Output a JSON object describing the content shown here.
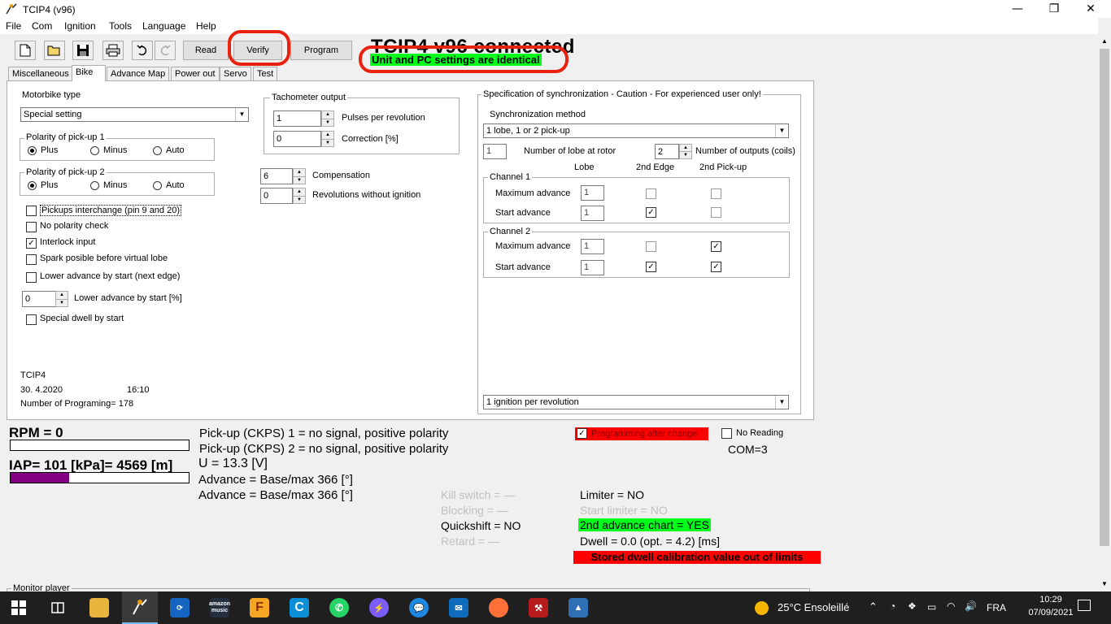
{
  "window": {
    "title": "TCIP4 (v96)",
    "min": "—",
    "max": "❐",
    "close": "✕"
  },
  "menu": [
    "File",
    "Com",
    "Ignition",
    "Tools",
    "Language",
    "Help"
  ],
  "toolbar": {
    "read": "Read",
    "verify": "Verify",
    "program": "Program"
  },
  "header": {
    "status": "TCIP4 v96 connected",
    "sub": "Unit and PC settings are identical"
  },
  "tabs": [
    "Miscellaneous",
    "Bike",
    "Advance Map",
    "Power out",
    "Servo",
    "Test"
  ],
  "bike": {
    "motorbike_type_label": "Motorbike type",
    "motorbike_type_value": "Special setting",
    "pol1_label": "Polarity of pick-up 1",
    "pol2_label": "Polarity of pick-up 2",
    "radio_options": [
      "Plus",
      "Minus",
      "Auto"
    ],
    "checks": [
      "Pickups interchange (pin 9 and 20)",
      "No polarity check",
      "Interlock input",
      "Spark posible before virtual lobe",
      "Lower advance by start (next edge)"
    ],
    "lower_adv_value": "0",
    "lower_adv_label": "Lower advance by start [%]",
    "special_dwell": "Special dwell by start",
    "tacho_label": "Tachometer output",
    "pulses_value": "1",
    "pulses_label": "Pulses per revolution",
    "correction_value": "0",
    "correction_label": "Correction [%]",
    "compensation_value": "6",
    "compensation_label": "Compensation",
    "rev_wo_ign_value": "0",
    "rev_wo_ign_label": "Revolutions without ignition",
    "info_name": "TCIP4",
    "info_date": "30. 4.2020",
    "info_time": "16:10",
    "info_prog": "Number of Programing= 178"
  },
  "sync": {
    "label": "Specification of synchronization - Caution - For experienced user only!",
    "method_label": "Synchronization method",
    "method_value": "1 lobe, 1 or 2 pick-up",
    "lobe_count": "1",
    "lobe_count_label": "Number of lobe at rotor",
    "outputs_value": "2",
    "outputs_label": "Number of outputs (coils)",
    "col_lobe": "Lobe",
    "col_edge": "2nd Edge",
    "col_pickup": "2nd Pick-up",
    "ch1_label": "Channel 1",
    "ch2_label": "Channel 2",
    "max_adv": "Maximum advance",
    "start_adv": "Start advance",
    "ch1_max_lobe": "1",
    "ch1_start_lobe": "1",
    "ch2_max_lobe": "1",
    "ch2_start_lobe": "1",
    "ign_per_rev": "1 ignition per revolution"
  },
  "status": {
    "rpm": "RPM = 0",
    "iap": "IAP= 101 [kPa]= 4569 [m]",
    "iap_level": 0.33,
    "pickup1": "Pick-up (CKPS) 1 = no signal, positive polarity",
    "pickup2": "Pick-up (CKPS) 2 = no signal, positive polarity",
    "voltage": "U = 13.3 [V]",
    "adv1": "Advance = Base/max 366 [°]",
    "adv2": "Advance = Base/max 366 [°]",
    "prog_after_change": "Programming after change",
    "no_reading": "No Reading",
    "com": "COM=3",
    "kill_switch": "Kill switch = —",
    "blocking": "Blocking = —",
    "quickshift": "Quickshift = NO",
    "retard": "Retard = —",
    "limiter": "Limiter = NO",
    "start_limiter": "Start limiter = NO",
    "second_chart": "2nd advance chart = YES",
    "dwell": "Dwell = 0.0 (opt. = 4.2) [ms]",
    "stored_dwell": "Stored dwell calibration value out of limits",
    "monitor_player": "Monitor player"
  },
  "colors": {
    "green": "#00ff1a",
    "red": "#ff0000",
    "iap_bar": "#800080",
    "ring": "#e8220f"
  },
  "taskbar": {
    "weather": "25°C  Ensoleillé",
    "lang": "FRA",
    "time": "10:29",
    "date": "07/09/2021",
    "amazon_label": "amazon music"
  }
}
